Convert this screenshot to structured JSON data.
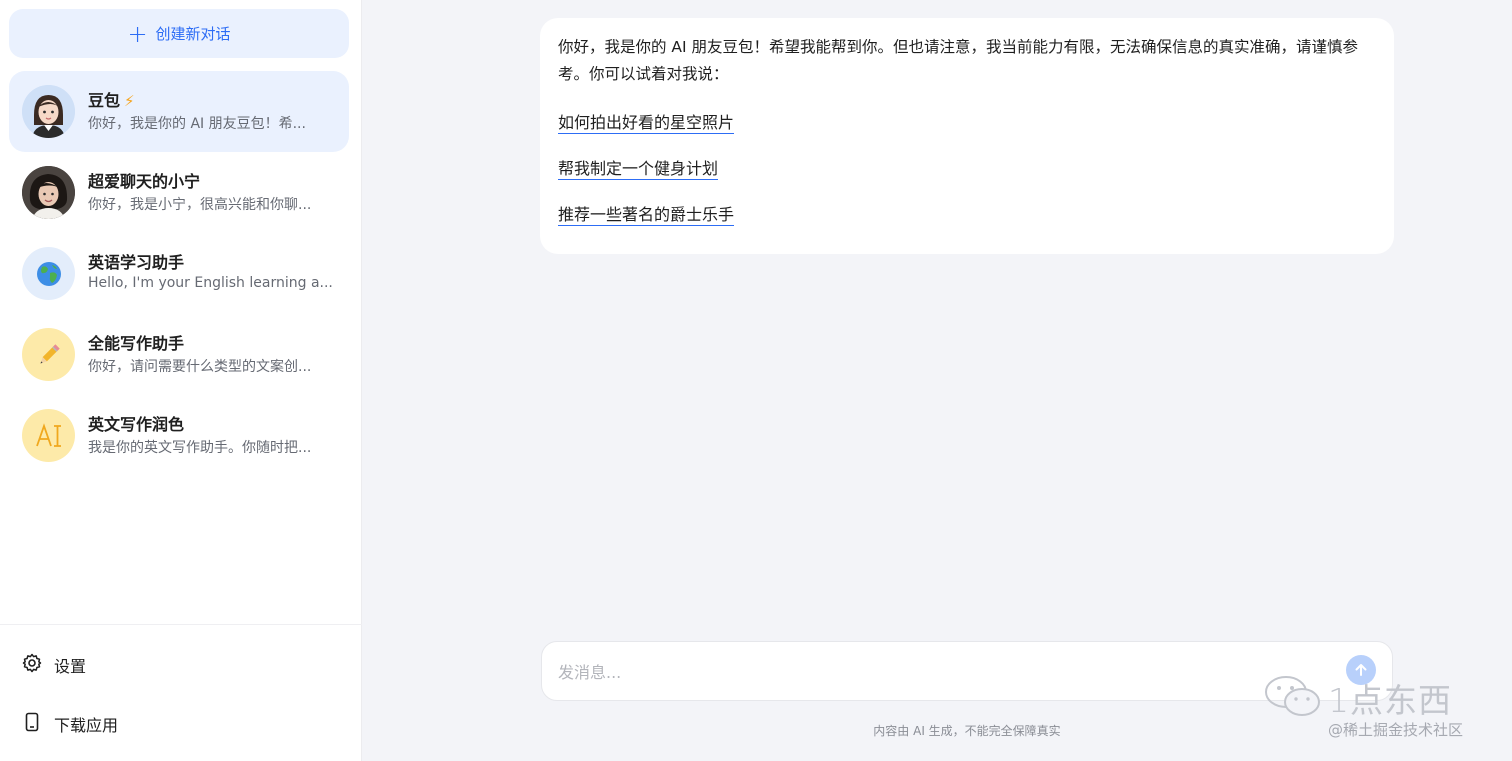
{
  "sidebar": {
    "new_chat_label": "创建新对话",
    "conversations": [
      {
        "name": "豆包",
        "badge": "⚡",
        "preview": "你好，我是你的 AI 朋友豆包！希...",
        "active": true,
        "avatar_icon": "girl-avatar-icon"
      },
      {
        "name": "超爱聊天的小宁",
        "preview": "你好，我是小宁，很高兴能和你聊...",
        "active": false,
        "avatar_icon": "woman-photo-avatar-icon"
      },
      {
        "name": "英语学习助手",
        "preview": "Hello, I'm your English learning a...",
        "active": false,
        "avatar_icon": "globe-icon"
      },
      {
        "name": "全能写作助手",
        "preview": "你好，请问需要什么类型的文案创...",
        "active": false,
        "avatar_icon": "pencil-icon"
      },
      {
        "name": "英文写作润色",
        "preview": "我是你的英文写作助手。你随时把...",
        "active": false,
        "avatar_icon": "ai-text-icon"
      }
    ],
    "footer": {
      "settings_label": "设置",
      "download_label": "下载应用"
    }
  },
  "chat": {
    "intro": "你好，我是你的 AI 朋友豆包！希望我能帮到你。但也请注意，我当前能力有限，无法确保信息的真实准确，请谨慎参考。你可以试着对我说：",
    "suggestions": [
      "如何拍出好看的星空照片",
      "帮我制定一个健身计划",
      "推荐一些著名的爵士乐手"
    ]
  },
  "composer": {
    "placeholder": "发消息...",
    "disclaimer": "内容由 AI 生成，不能完全保障真实"
  },
  "watermark": {
    "title": "1点东西",
    "subtitle": "@稀土掘金技术社区"
  },
  "colors": {
    "accent": "#2d6df5",
    "active_bg": "#eaf1fe",
    "page_bg": "#f3f4f8"
  }
}
